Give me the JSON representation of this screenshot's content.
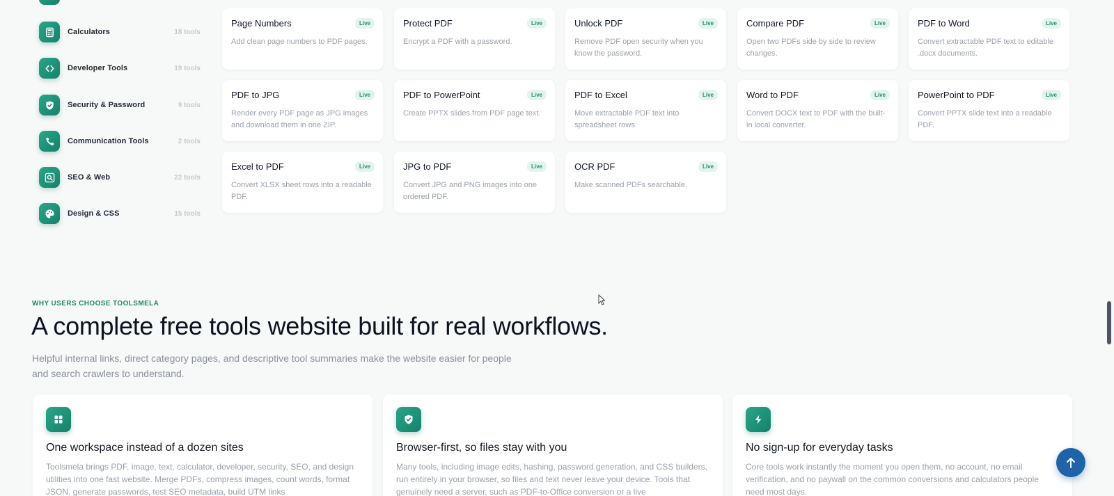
{
  "sidebar": {
    "items": [
      {
        "label": "Calculators",
        "count": "18 tools",
        "icon": "calculator-icon"
      },
      {
        "label": "Developer Tools",
        "count": "19 tools",
        "icon": "code-icon"
      },
      {
        "label": "Security & Password",
        "count": "9 tools",
        "icon": "shield-check-icon"
      },
      {
        "label": "Communication Tools",
        "count": "2 tools",
        "icon": "phone-icon"
      },
      {
        "label": "SEO & Web",
        "count": "22 tools",
        "icon": "search-web-icon"
      },
      {
        "label": "Design & CSS",
        "count": "15 tools",
        "icon": "palette-icon"
      }
    ]
  },
  "tools": [
    {
      "title": "Page Numbers",
      "badge": "Live",
      "desc": "Add clean page numbers to PDF pages."
    },
    {
      "title": "Protect PDF",
      "badge": "Live",
      "desc": "Encrypt a PDF with a password."
    },
    {
      "title": "Unlock PDF",
      "badge": "Live",
      "desc": "Remove PDF open security when you know the password."
    },
    {
      "title": "Compare PDF",
      "badge": "Live",
      "desc": "Open two PDFs side by side to review changes."
    },
    {
      "title": "PDF to Word",
      "badge": "Live",
      "desc": "Convert extractable PDF text to editable .docx documents."
    },
    {
      "title": "PDF to JPG",
      "badge": "Live",
      "desc": "Render every PDF page as JPG images and download them in one ZIP."
    },
    {
      "title": "PDF to PowerPoint",
      "badge": "Live",
      "desc": "Create PPTX slides from PDF page text."
    },
    {
      "title": "PDF to Excel",
      "badge": "Live",
      "desc": "Move extractable PDF text into spreadsheet rows."
    },
    {
      "title": "Word to PDF",
      "badge": "Live",
      "desc": "Convert DOCX text to PDF with the built-in local converter."
    },
    {
      "title": "PowerPoint to PDF",
      "badge": "Live",
      "desc": "Convert PPTX slide text into a readable PDF."
    },
    {
      "title": "Excel to PDF",
      "badge": "Live",
      "desc": "Convert XLSX sheet rows into a readable PDF."
    },
    {
      "title": "JPG to PDF",
      "badge": "Live",
      "desc": "Convert JPG and PNG images into one ordered PDF."
    },
    {
      "title": "OCR PDF",
      "badge": "Live",
      "desc": "Make scanned PDFs searchable."
    }
  ],
  "section": {
    "eyebrow": "WHY USERS CHOOSE TOOLSMELA",
    "headline": "A complete free tools website built for real workflows.",
    "subtext": "Helpful internal links, direct category pages, and descriptive tool summaries make the website easier for people and search crawlers to understand."
  },
  "features": [
    {
      "icon": "grid-icon",
      "title": "One workspace instead of a dozen sites",
      "desc": "Toolsmela brings PDF, image, text, calculator, developer, security, SEO, and design utilities into one fast website. Merge PDFs, compress images, count words, format JSON, generate passwords, test SEO metadata, build UTM links"
    },
    {
      "icon": "shield-check-icon",
      "title": "Browser-first, so files stay with you",
      "desc": "Many tools, including image edits, hashing, password generation, and CSS builders, run entirely in your browser, so files and text never leave your device. Tools that genuinely need a server, such as PDF-to-Office conversion or a live"
    },
    {
      "icon": "lightning-icon",
      "title": "No sign-up for everyday tasks",
      "desc": "Core tools work instantly the moment you open them, no account, no email verification, and no paywall on the common conversions and calculators people need most days."
    }
  ],
  "colors": {
    "accent": "#1c8f6f",
    "badge_bg": "#e3f4ee",
    "back_to_top": "#1f63a8"
  }
}
